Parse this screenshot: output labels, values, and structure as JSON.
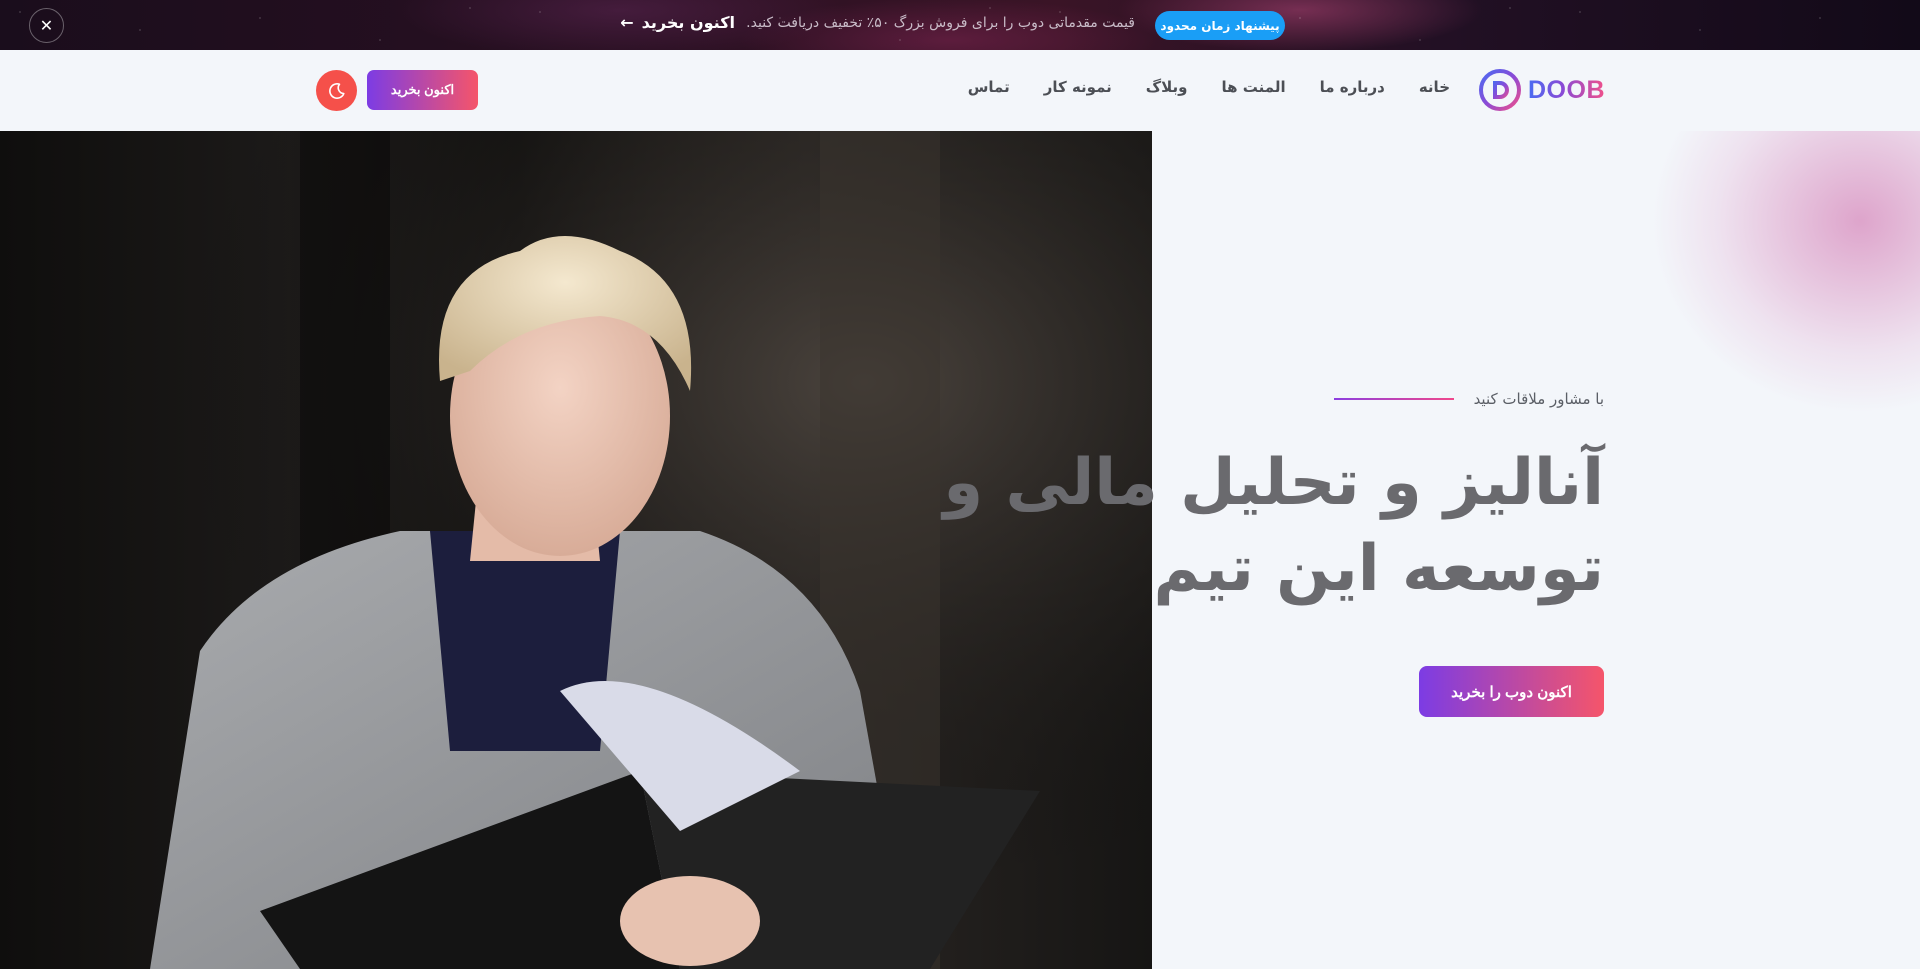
{
  "promo": {
    "badge": "پیشنهاد زمان محدود",
    "text": "قیمت مقدماتی دوب را برای فروش بزرگ ۵۰٪ تخفیف دریافت کنید.",
    "cta": "اکنون بخرید",
    "close_icon": "✕"
  },
  "header": {
    "logo_text": "DOOB",
    "nav": [
      "خانه",
      "درباره ما",
      "المنت ها",
      "وبلاگ",
      "نمونه کار",
      "تماس"
    ],
    "buy_label": "اکنون بخرید"
  },
  "hero": {
    "subtitle": "با مشاور ملاقات کنید",
    "title_line1": "آنالیز و تحلیل مالی و",
    "title_line2": "توسعه این تیم",
    "cta": "اکنون دوب را بخرید"
  },
  "icons": {
    "promo_arrow": "arrow-left-icon",
    "close": "close-icon",
    "theme": "moon-icon",
    "logo": "doob-logo-icon"
  },
  "colors": {
    "accent_start": "#7c3ce4",
    "accent_end": "#f5556a",
    "badge": "#1a9ef6",
    "toggle": "#f5504a"
  }
}
